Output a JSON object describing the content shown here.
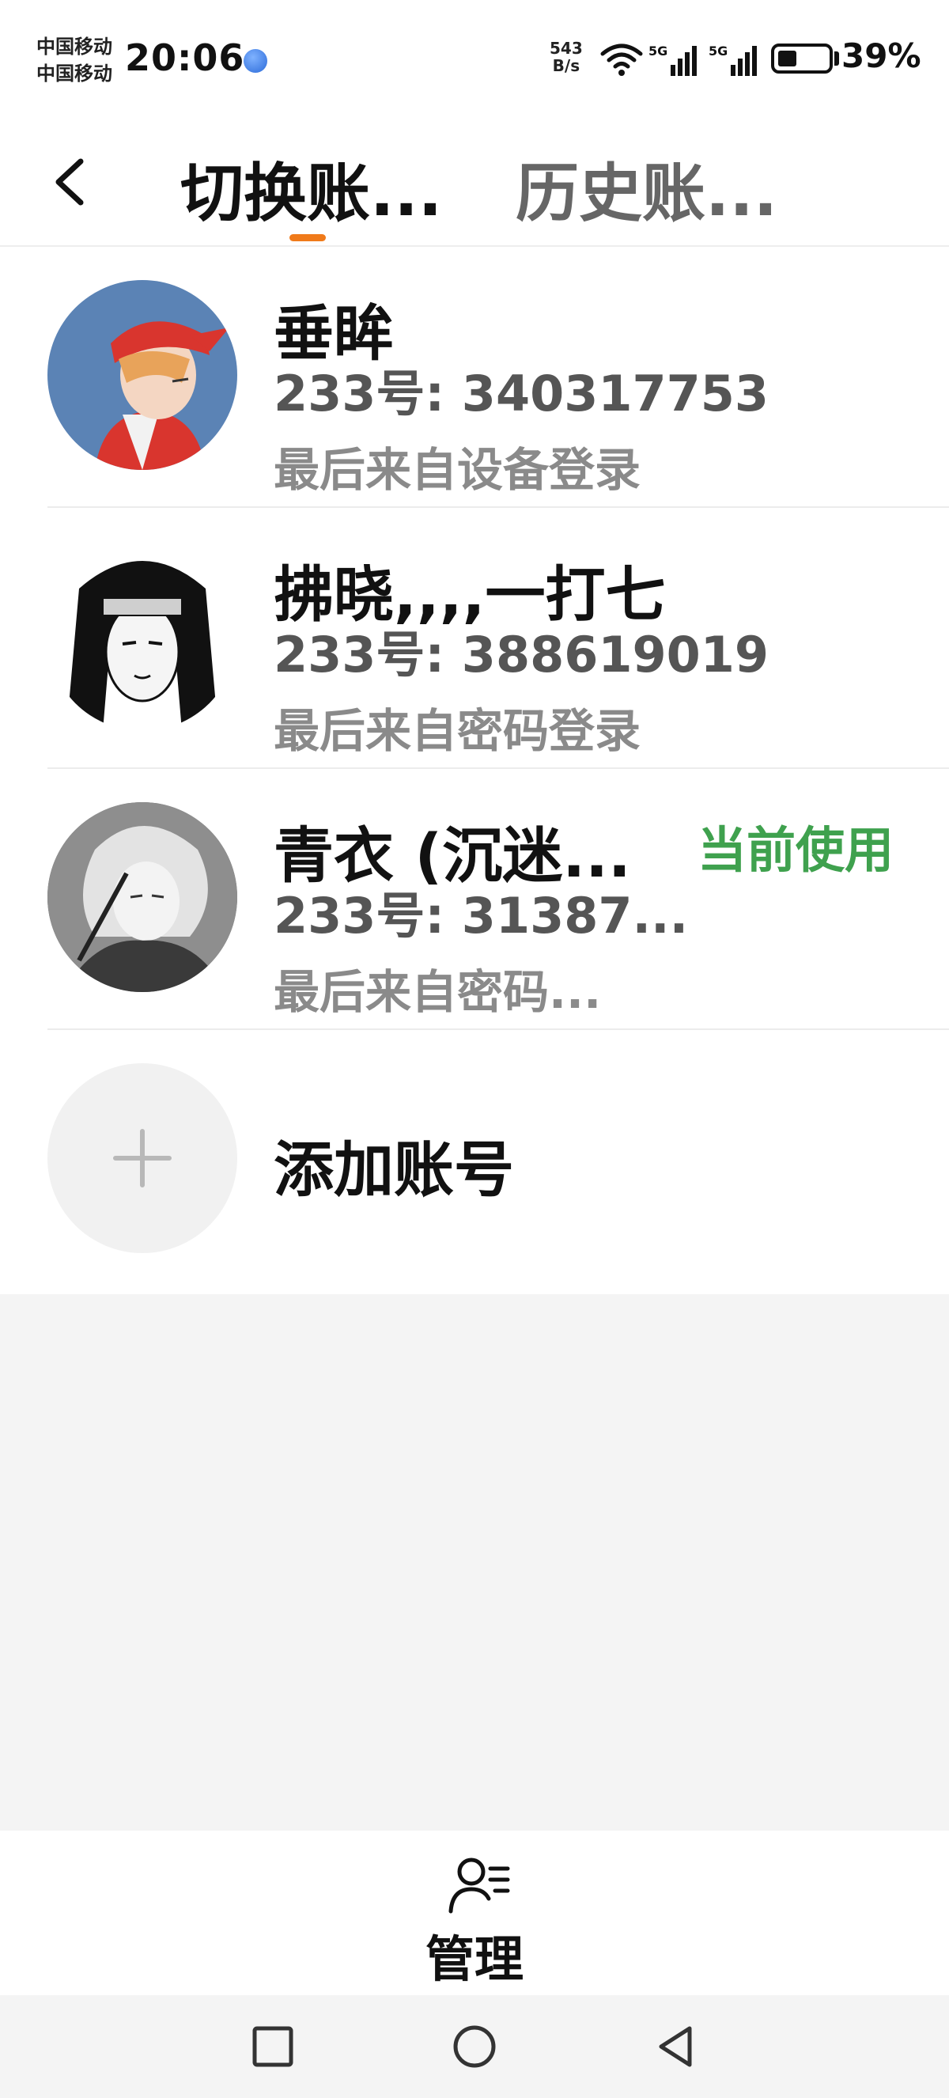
{
  "status_bar": {
    "carrier_1": "中国移动",
    "carrier_2": "中国移动",
    "time": "20:06",
    "net_speed_value": "543",
    "net_speed_unit": "B/s",
    "signal_1_label": "5G",
    "signal_2_label": "5G",
    "battery_percent": "39%",
    "battery_level": 0.39
  },
  "header": {
    "tabs": [
      {
        "label": "切换账...",
        "active": true
      },
      {
        "label": "历史账...",
        "active": false
      }
    ],
    "accent_color": "#f07a1a"
  },
  "accounts": [
    {
      "name": "垂眸",
      "id_text": "233号: 340317753",
      "login_text": "最后来自设备登录",
      "current": false,
      "avatar": "avatar-boy-red-cap"
    },
    {
      "name": "拂晓,,,,一打七",
      "id_text": "233号: 388619019",
      "login_text": "最后来自密码登录",
      "current": false,
      "avatar": "avatar-ninja-sketch"
    },
    {
      "name": "青衣 (沉迷...",
      "id_text": "233号: 31387...",
      "login_text": "最后来自密码...",
      "current": true,
      "current_label": "当前使用",
      "avatar": "avatar-silver-hair"
    }
  ],
  "add_account": {
    "label": "添加账号",
    "icon": "plus-icon"
  },
  "bottom_bar": {
    "manage_label": "管理",
    "manage_icon": "user-list-icon"
  },
  "colors": {
    "current_badge": "#3fa14e",
    "secondary_text": "#8a8a8a",
    "background_gray": "#f4f4f4"
  },
  "system_nav": {
    "buttons": [
      "recents-square-icon",
      "home-circle-icon",
      "back-triangle-icon"
    ]
  }
}
